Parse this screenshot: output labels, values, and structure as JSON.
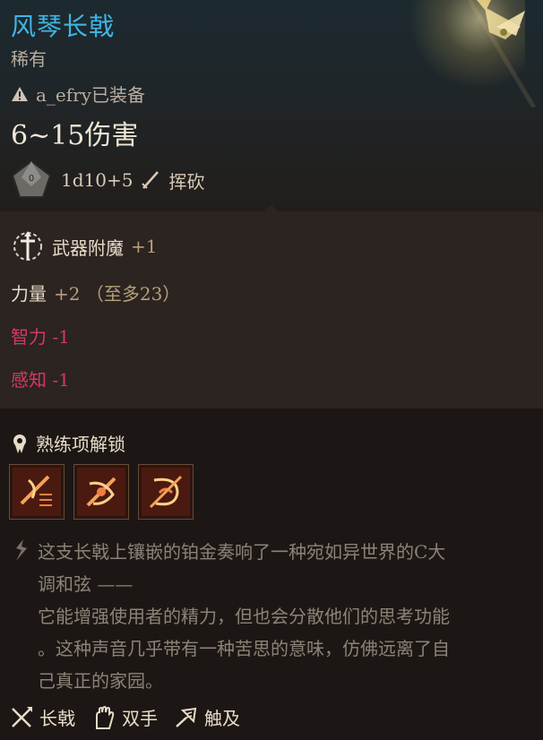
{
  "item": {
    "name": "风琴长戟",
    "rarity": "稀有",
    "equipped_by": "a_efry已装备",
    "damage": "6~15伤害",
    "dice_formula": "1d10+5",
    "damage_type": "挥砍"
  },
  "enchantment": {
    "label": "武器附魔",
    "value": "+1"
  },
  "stats": [
    {
      "label": "力量",
      "value": "+2 （至多23）",
      "negative": false
    },
    {
      "label": "智力 -1",
      "value": "",
      "negative": true
    },
    {
      "label": "感知 -1",
      "value": "",
      "negative": true
    }
  ],
  "proficiency": {
    "title": "熟练项解锁",
    "icons": [
      "weapon-action-icon-1",
      "weapon-action-icon-2",
      "weapon-action-icon-3"
    ]
  },
  "lore": {
    "line1": "这支长戟上镶嵌的铂金奏响了一种宛如异世界的C大",
    "line2": "调和弦 ——",
    "line3": "它能增强使用者的精力，但也会分散他们的思考功能",
    "line4": "。这种声音几乎带有一种苦思的意味，仿佛远离了自",
    "line5": "己真正的家园。"
  },
  "tags": [
    {
      "icon": "halberd-icon",
      "label": "长戟"
    },
    {
      "icon": "two-handed-icon",
      "label": "双手"
    },
    {
      "icon": "reach-icon",
      "label": "触及"
    }
  ],
  "colors": {
    "title": "#3fb6e4",
    "negative": "#d23a63",
    "bonus": "#b8a07a"
  }
}
